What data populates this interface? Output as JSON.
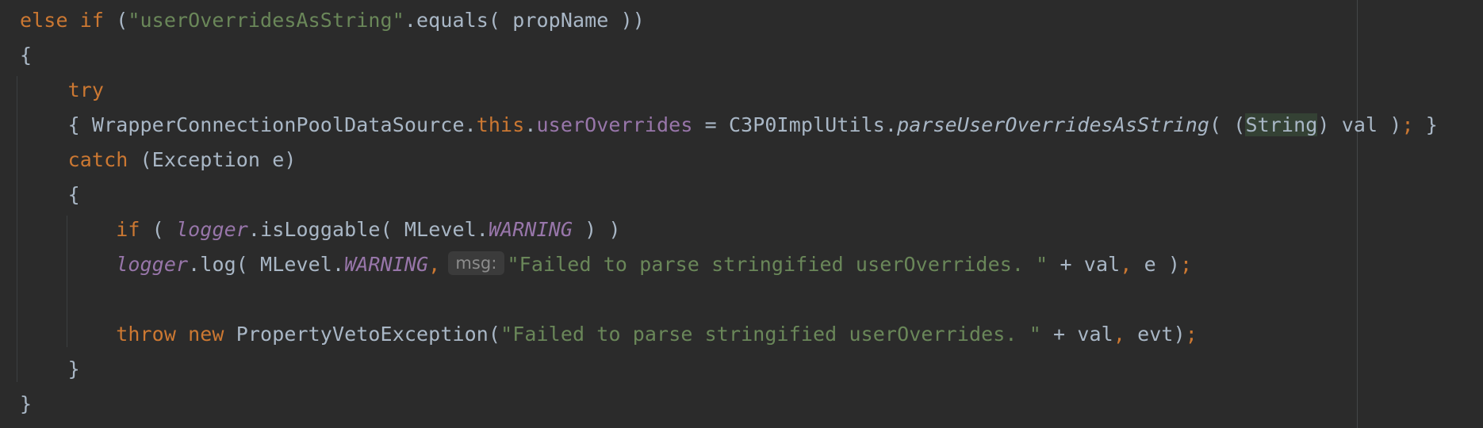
{
  "editor": {
    "lines": [
      [
        {
          "t": "else if",
          "c": "kw"
        },
        {
          "t": " ("
        },
        {
          "t": "\"userOverridesAsString\"",
          "c": "str"
        },
        {
          "t": ".equals( propName ))"
        }
      ],
      [
        {
          "t": "{"
        }
      ],
      [
        {
          "t": "    "
        },
        {
          "t": "try",
          "c": "kw"
        }
      ],
      [
        {
          "t": "    { WrapperConnectionPoolDataSource."
        },
        {
          "t": "this",
          "c": "kw"
        },
        {
          "t": "."
        },
        {
          "t": "userOverrides",
          "c": "field"
        },
        {
          "t": " = C3P0ImplUtils."
        },
        {
          "t": "parseUserOverridesAsString",
          "c": "italic"
        },
        {
          "t": "( ("
        },
        {
          "t": "String",
          "c": "hl"
        },
        {
          "t": ") val )"
        },
        {
          "t": ";",
          "c": "punct"
        },
        {
          "t": " }"
        }
      ],
      [
        {
          "t": "    "
        },
        {
          "t": "catch",
          "c": "kw"
        },
        {
          "t": " (Exception e)"
        }
      ],
      [
        {
          "t": "    {"
        }
      ],
      [
        {
          "t": "        "
        },
        {
          "t": "if",
          "c": "kw"
        },
        {
          "t": " ( "
        },
        {
          "t": "logger",
          "c": "static"
        },
        {
          "t": ".isLoggable( MLevel."
        },
        {
          "t": "WARNING",
          "c": "static"
        },
        {
          "t": " ) )"
        }
      ],
      [
        {
          "t": "        "
        },
        {
          "t": "logger",
          "c": "static"
        },
        {
          "t": ".log( MLevel."
        },
        {
          "t": "WARNING",
          "c": "static"
        },
        {
          "t": ",",
          "c": "punct"
        },
        {
          "t": "msg:",
          "c": "hint"
        },
        {
          "t": "\"Failed to parse stringified userOverrides. \"",
          "c": "str"
        },
        {
          "t": " + val"
        },
        {
          "t": ",",
          "c": "punct"
        },
        {
          "t": " e )"
        },
        {
          "t": ";",
          "c": "punct"
        }
      ],
      [],
      [
        {
          "t": "        "
        },
        {
          "t": "throw new",
          "c": "kw"
        },
        {
          "t": " PropertyVetoException("
        },
        {
          "t": "\"Failed to parse stringified userOverrides. \"",
          "c": "str"
        },
        {
          "t": " + val"
        },
        {
          "t": ",",
          "c": "punct"
        },
        {
          "t": " evt)"
        },
        {
          "t": ";",
          "c": "punct"
        }
      ],
      [
        {
          "t": "    }"
        }
      ],
      [
        {
          "t": "}"
        }
      ]
    ]
  },
  "colors": {
    "background": "#2b2b2b",
    "default_text": "#a9b7c6",
    "keyword": "#cc7832",
    "string": "#6a8759",
    "field": "#9876aa",
    "static_field": "#9876aa",
    "inlay_hint_bg": "#3b3b3b",
    "inlay_hint_text": "#8c8c8c",
    "highlight_bg": "#344134"
  }
}
